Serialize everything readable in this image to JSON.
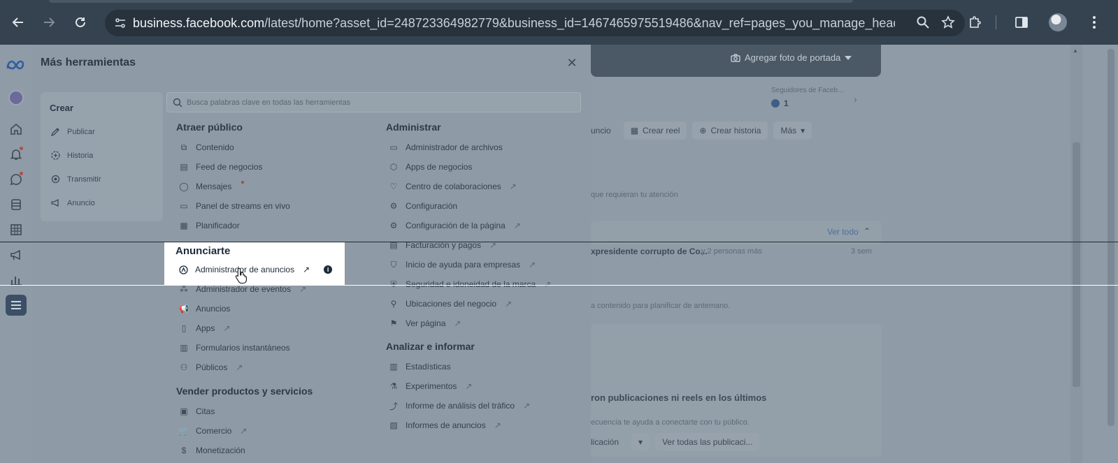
{
  "browser": {
    "url_host": "business.facebook.com",
    "url_path": "/latest/home?asset_id=248723364982779&business_id=1467465975519486&nav_ref=pages_you_manage_header_na..."
  },
  "background_page": {
    "cover_button": "Agregar foto de portada",
    "followers_label": "Seguidores de Faceb...",
    "followers_count": "1",
    "buttons": [
      "uncio",
      "Crear reel",
      "Crear historia",
      "Más"
    ],
    "attention_text": "que requieran tu atención",
    "see_all": "Ver todo",
    "notification_text": "xpresidente corrupto de Co...",
    "notification_more": "y 2 personas más",
    "notification_time": "3 sem",
    "plan_text": "a contenido para planificar de antemano.",
    "no_posts_title": "ron publicaciones ni reels en los últimos",
    "frequency_text": "ecuencia te ayuda a conectarte con tu público.",
    "publish_btn": "licación",
    "see_all_posts": "Ver todas las publicaci..."
  },
  "modal": {
    "title": "Más herramientas",
    "search_placeholder": "Busca palabras clave en todas las herramientas",
    "create": {
      "title": "Crear",
      "items": [
        "Publicar",
        "Historia",
        "Transmitir",
        "Anuncio"
      ]
    },
    "atraer": {
      "title": "Atraer público",
      "items": [
        "Contenido",
        "Feed de negocios",
        "Mensajes",
        "Panel de streams en vivo",
        "Planificador"
      ]
    },
    "anunciarte": {
      "title": "Anunciarte",
      "items": [
        "Administrador de anuncios",
        "Administrador de eventos",
        "Anuncios",
        "Apps",
        "Formularios instantáneos",
        "Públicos"
      ]
    },
    "vender": {
      "title": "Vender productos y servicios",
      "items": [
        "Citas",
        "Comercio",
        "Monetización"
      ]
    },
    "administrar": {
      "title": "Administrar",
      "items": [
        "Administrador de archivos",
        "Apps de negocios",
        "Centro de colaboraciones",
        "Configuración",
        "Configuración de la página",
        "Facturación y pagos",
        "Inicio de ayuda para empresas",
        "Seguridad e idoneidad de la marca",
        "Ubicaciones del negocio",
        "Ver página"
      ]
    },
    "analizar": {
      "title": "Analizar e informar",
      "items": [
        "Estadísticas",
        "Experimentos",
        "Informe de análisis del tráfico",
        "Informes de anuncios"
      ]
    }
  }
}
